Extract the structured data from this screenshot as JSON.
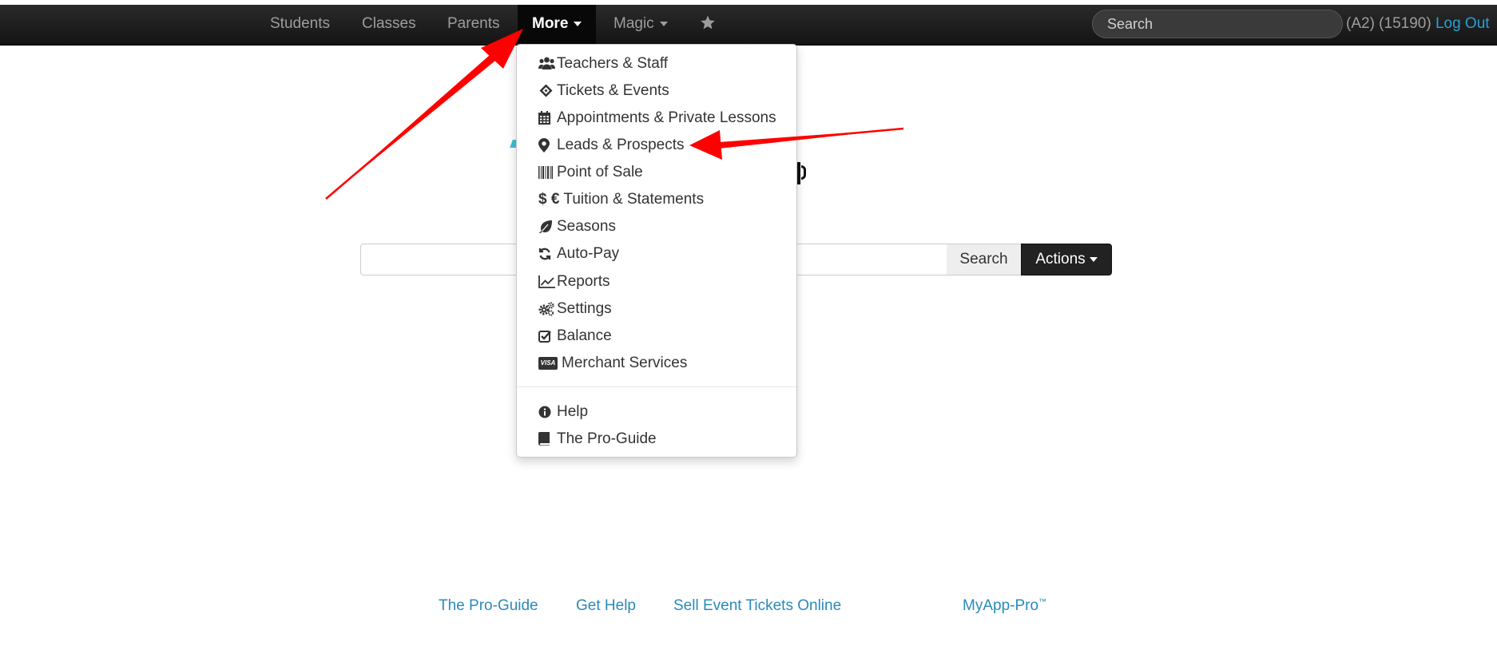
{
  "navbar": {
    "items": [
      {
        "label": "Students"
      },
      {
        "label": "Classes"
      },
      {
        "label": "Parents"
      },
      {
        "label": "More"
      },
      {
        "label": "Magic"
      }
    ],
    "search_placeholder": "Search",
    "account_info": "(A2) (15190)",
    "logout_label": "Log Out"
  },
  "dropdown": {
    "items": [
      {
        "label": "Teachers & Staff",
        "icon": "users-icon"
      },
      {
        "label": "Tickets & Events",
        "icon": "ticket-icon"
      },
      {
        "label": "Appointments & Private Lessons",
        "icon": "calendar-icon"
      },
      {
        "label": "Leads & Prospects",
        "icon": "map-marker-icon"
      },
      {
        "label": "Point of Sale",
        "icon": "barcode-icon"
      },
      {
        "label": "Tuition & Statements",
        "icon": "dollar-euro-icon"
      },
      {
        "label": "Seasons",
        "icon": "leaf-icon"
      },
      {
        "label": "Auto-Pay",
        "icon": "refresh-icon"
      },
      {
        "label": "Reports",
        "icon": "line-chart-icon"
      },
      {
        "label": "Settings",
        "icon": "cogs-icon"
      },
      {
        "label": "Balance",
        "icon": "check-square-icon"
      },
      {
        "label": "Merchant Services",
        "icon": "visa-card-icon"
      },
      {
        "label": "Help",
        "icon": "info-circle-icon"
      },
      {
        "label": "The Pro-Guide",
        "icon": "book-icon"
      }
    ],
    "currency_symbols": "$ €",
    "visa_text": "VISA"
  },
  "main": {
    "search_button": "Search",
    "actions_button": "Actions"
  },
  "footer": {
    "links": [
      "The Pro-Guide",
      "Get Help",
      "Sell Event Tickets Online",
      "MyApp-Pro"
    ],
    "trademark": "™"
  },
  "colors": {
    "navbar_bg": "#141414",
    "link": "#2a8ab8",
    "logout_link": "#2a9fd6",
    "annotation_arrow": "#ff0000"
  }
}
